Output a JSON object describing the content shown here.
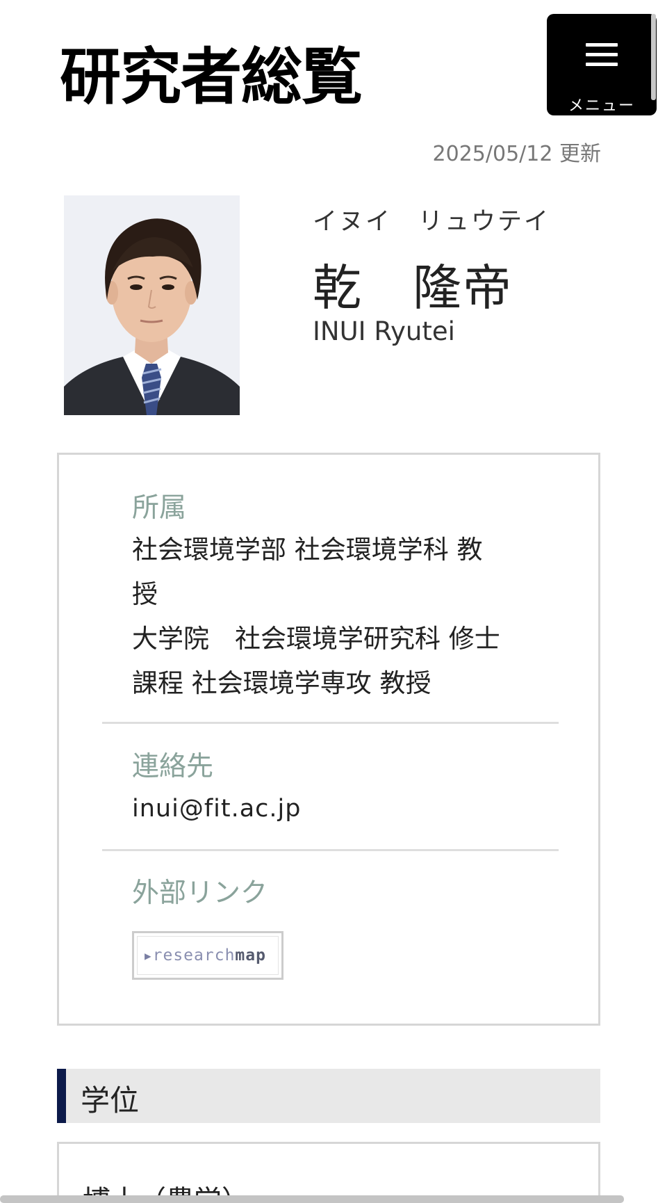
{
  "header": {
    "site_title": "研究者総覧",
    "menu_label": "メニュー",
    "menu_icon": "hamburger-icon"
  },
  "updated_text": "2025/05/12 更新",
  "profile": {
    "kana": "イヌイ　リュウテイ",
    "name_jp": "乾　隆帝",
    "name_en": "INUI Ryutei"
  },
  "info": {
    "affiliation_label": "所属",
    "affiliation_lines": [
      "社会環境学部 社会環境学科 教",
      "授",
      "大学院　社会環境学研究科 修士",
      "課程 社会環境学専攻 教授"
    ],
    "contact_label": "連絡先",
    "contact_email": "inui@fit.ac.jp",
    "external_label": "外部リンク",
    "researchmap": {
      "part1": "research",
      "part2": "map"
    }
  },
  "degree": {
    "heading": "学位",
    "value": "博士（農学）"
  },
  "colors": {
    "accent_bar": "#0c1a4a",
    "section_label": "#8aa39b",
    "menu_bg": "#000000"
  }
}
